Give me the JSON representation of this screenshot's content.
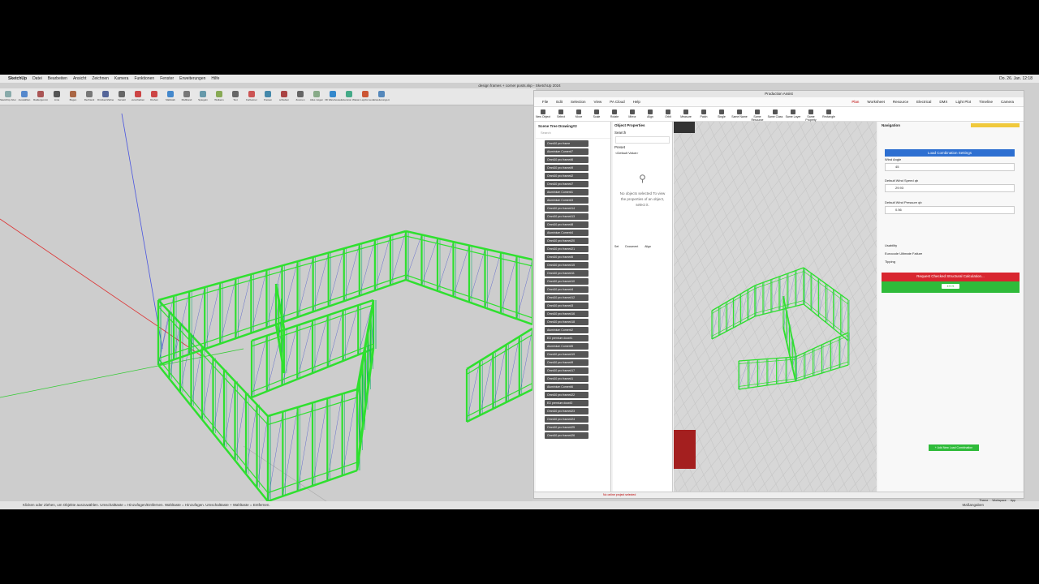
{
  "menubar": {
    "apple": "",
    "app": "SketchUp",
    "items": [
      "Datei",
      "Bearbeiten",
      "Ansicht",
      "Zeichnen",
      "Kamera",
      "Funktionen",
      "Fenster",
      "Erweiterungen",
      "Hilfe"
    ],
    "clock": "Do. 26. Jan. 12:18"
  },
  "sketchup": {
    "title": "design frames + corner posts.skp - SketchUp 2024",
    "tools": [
      "SketchUp Abonnement",
      "Auswählen",
      "Radiergummi",
      "Linie",
      "Bogen",
      "Rechteck",
      "Drücken/Ziehen",
      "Versatz",
      "verschieben",
      "Drehen",
      "Maßstab",
      "Maßband",
      "Spiegeln",
      "Wolkens",
      "Text",
      "Farbeimer",
      "Kreisen",
      "schieben",
      "Zoomen",
      "Alles zeigen",
      "3D Warehouse",
      "Extension Warehouse",
      "an LayOut senden",
      "Erweiterungs-Manager"
    ],
    "status": "Klicken oder Ziehen, um Objekte auszuwählen. Umschalttaste = Hinzufügen/Entfernen. Wahltaste = Hinzufügen. Umschalttaste + Wahltaste = Entfernen.",
    "measurement": "Maßangaben"
  },
  "pa": {
    "title": "Production Assist",
    "menu": [
      "File",
      "Edit",
      "Selection",
      "View",
      "PA Cloud",
      "Help"
    ],
    "tabs": [
      "Plan",
      "Worksheet",
      "Resource",
      "Electrical",
      "DMX",
      "Light Plot",
      "Timeline",
      "Camera"
    ],
    "tools": [
      "New Object",
      "Select",
      "Move",
      "Scale",
      "Rotate",
      "Mirror",
      "Align",
      "Orbit",
      "Measure",
      "Patch",
      "Single",
      "Same Name",
      "Same Resource",
      "Same Class",
      "Same Layer",
      "Same Property",
      "Rectangle"
    ],
    "tree": {
      "title": "Scene Tree Drawing#2",
      "search": "Search",
      "items": [
        "Omni10 pro frame",
        "Aluminium Corner#7",
        "Omni10 pro frame#6",
        "Omni10 pro frame#9",
        "Omni10 pro frame#2",
        "Omni10 pro frame#7",
        "Aluminium Corner#1",
        "Aluminium Corner#3",
        "Omni10 pro frame#14",
        "Omni10 pro frame#13",
        "Omni10 pro frame#8",
        "Aluminium Corner#4",
        "Omni10 pro frame#20",
        "Omni10 pro frame#21",
        "Omni10 pro frame#5",
        "Omni10 pro frame#15",
        "Omni10 pro frame#11",
        "Omni10 pro frame#10",
        "Omni10 pro frame#4",
        "Omni10 pro frame#12",
        "Omni10 pro frame#3",
        "Omni10 pro frame#16",
        "Omni10 pro frame#18",
        "Aluminium Corner#2",
        "ED premium door#1",
        "Aluminium Corner#5",
        "Omni10 pro frame#19",
        "Omni10 pro frame#9",
        "Omni10 pro frame#17",
        "Omni10 pro frame#1",
        "Aluminium Corner#6",
        "Omni10 pro frame#22",
        "ED premium door#2",
        "Omni10 pro frame#23",
        "Omni10 pro frame#24",
        "Omni10 pro frame#25",
        "Omni10 pro frame#26"
      ]
    },
    "props": {
      "title": "Object Properties",
      "search": "Search",
      "preset": "Preset",
      "preset_value": "<Default Value>",
      "empty": "No objects selected To view the properties of an object, select it.",
      "tabs": [
        "Set",
        "Document",
        "Align"
      ]
    },
    "nav": {
      "title": "Navigation",
      "load_btn": "Load Combination Settings",
      "wind_angle_label": "Wind Angle",
      "wind_angle": "45",
      "wind_speed_label": "Default Wind Speed qb",
      "wind_speed": "29.93",
      "wind_pressure_label": "Default Wind Pressure qb",
      "wind_pressure": "0.56",
      "checks": [
        "Usability",
        "Eurocode Ultimate Failure",
        "Tipping"
      ],
      "request_btn": "Request Checked Structural Calculation...",
      "price": "£70 €",
      "add_btn": "+ Add New Load Combination"
    },
    "status": "No online project selected",
    "bottom_right": [
      "Theme",
      "Workspace",
      "App"
    ]
  },
  "colors": {
    "frame_green": "#2fe02f",
    "edge_blue": "#2233cc",
    "accent_red": "#d8262f",
    "accent_blue": "#2d6fd1"
  }
}
